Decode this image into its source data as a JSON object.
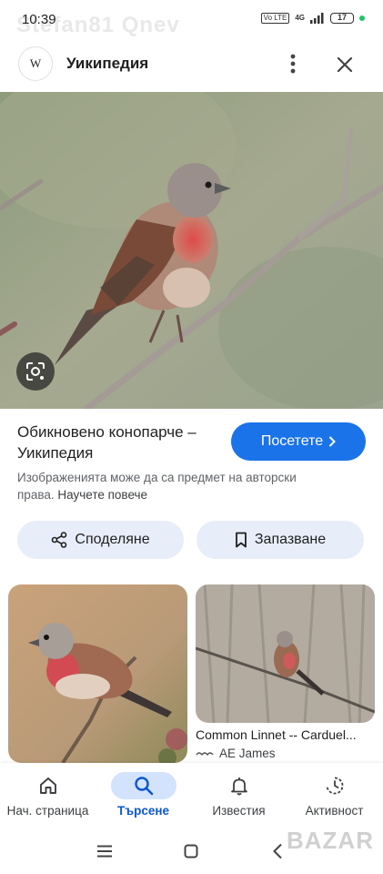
{
  "status_bar": {
    "time": "10:39",
    "overlay_text": "Stefan81 Qnev",
    "volte": "Vo LTE",
    "network": "4G",
    "battery": "17"
  },
  "header": {
    "site_logo": "W",
    "site_name": "Уикипедия"
  },
  "result": {
    "title": "Обикновено конопарче – Уикипедия",
    "visit_label": "Посетете",
    "copyright_text": "Изображенията може да са предмет на авторски права.",
    "learn_more": "Научете повече"
  },
  "actions": {
    "share_label": "Споделяне",
    "save_label": "Запазване"
  },
  "related": {
    "card2_title": "Common Linnet -- Carduel...",
    "card2_source": "AE James"
  },
  "bottom_nav": {
    "items": [
      {
        "label": "Нач. страница",
        "icon": "home-icon"
      },
      {
        "label": "Търсене",
        "icon": "search-icon",
        "active": true
      },
      {
        "label": "Известия",
        "icon": "bell-icon"
      },
      {
        "label": "Активност",
        "icon": "history-icon"
      }
    ]
  },
  "watermark": "BAZAR"
}
